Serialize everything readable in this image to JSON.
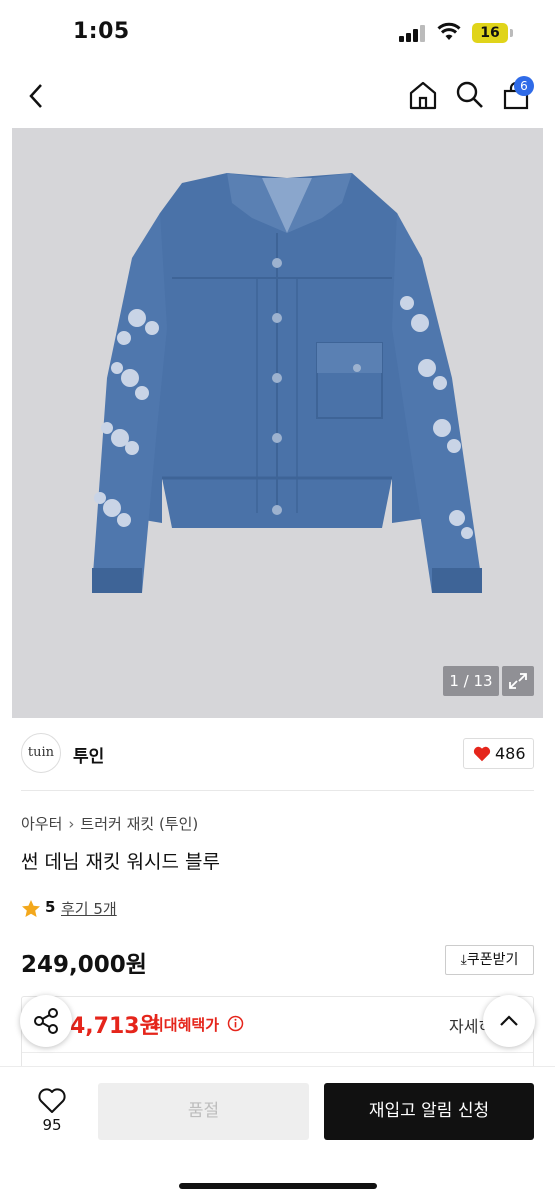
{
  "status": {
    "time": "1:05",
    "battery": "16"
  },
  "header": {
    "cart_count": "6",
    "icons": [
      "back-icon",
      "home-icon",
      "search-icon",
      "cart-icon"
    ]
  },
  "image": {
    "counter": "1 / 13"
  },
  "brand": {
    "logo_text": "tuin",
    "name": "투인",
    "likes": "486"
  },
  "breadcrumb": {
    "category": "아우터",
    "subcategory": "트러커 재킷 (투인)"
  },
  "product": {
    "title": "썬 데님 재킷 워시드 블루",
    "rating": "5",
    "reviews": "후기 5개",
    "price": "249,000원"
  },
  "coupon": {
    "label": "쿠폰받기"
  },
  "benefit": {
    "price": "4,713원",
    "label": "최대혜택가",
    "detail": "자세히"
  },
  "bottom": {
    "wish_count": "95",
    "soldout_label": "품절",
    "restock_label": "재입고 알림 신청"
  },
  "colors": {
    "accent_red": "#e5251b",
    "badge_blue": "#2f6be8",
    "denim": "#4a72a8"
  }
}
